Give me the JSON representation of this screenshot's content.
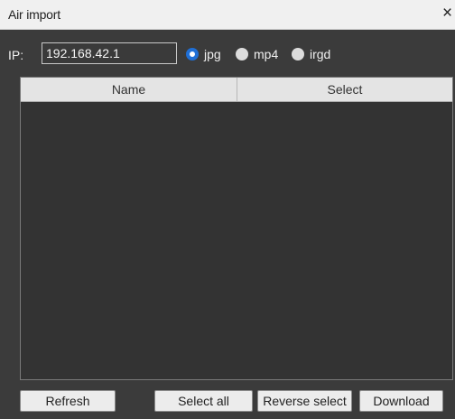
{
  "window": {
    "title": "Air import",
    "close_glyph": "×"
  },
  "connection": {
    "ip_label": "IP:",
    "ip_value": "192.168.42.1"
  },
  "file_types": [
    {
      "label": "jpg",
      "checked": true
    },
    {
      "label": "mp4",
      "checked": false
    },
    {
      "label": "irgd",
      "checked": false
    }
  ],
  "table": {
    "columns": [
      "Name",
      "Select"
    ],
    "rows": []
  },
  "buttons": {
    "refresh": "Refresh",
    "select_all": "Select all",
    "reverse_select": "Reverse select",
    "download": "Download"
  },
  "colors": {
    "accent": "#1f6fd6",
    "background": "#3b3b3b",
    "titlebar": "#f0f0f0"
  }
}
